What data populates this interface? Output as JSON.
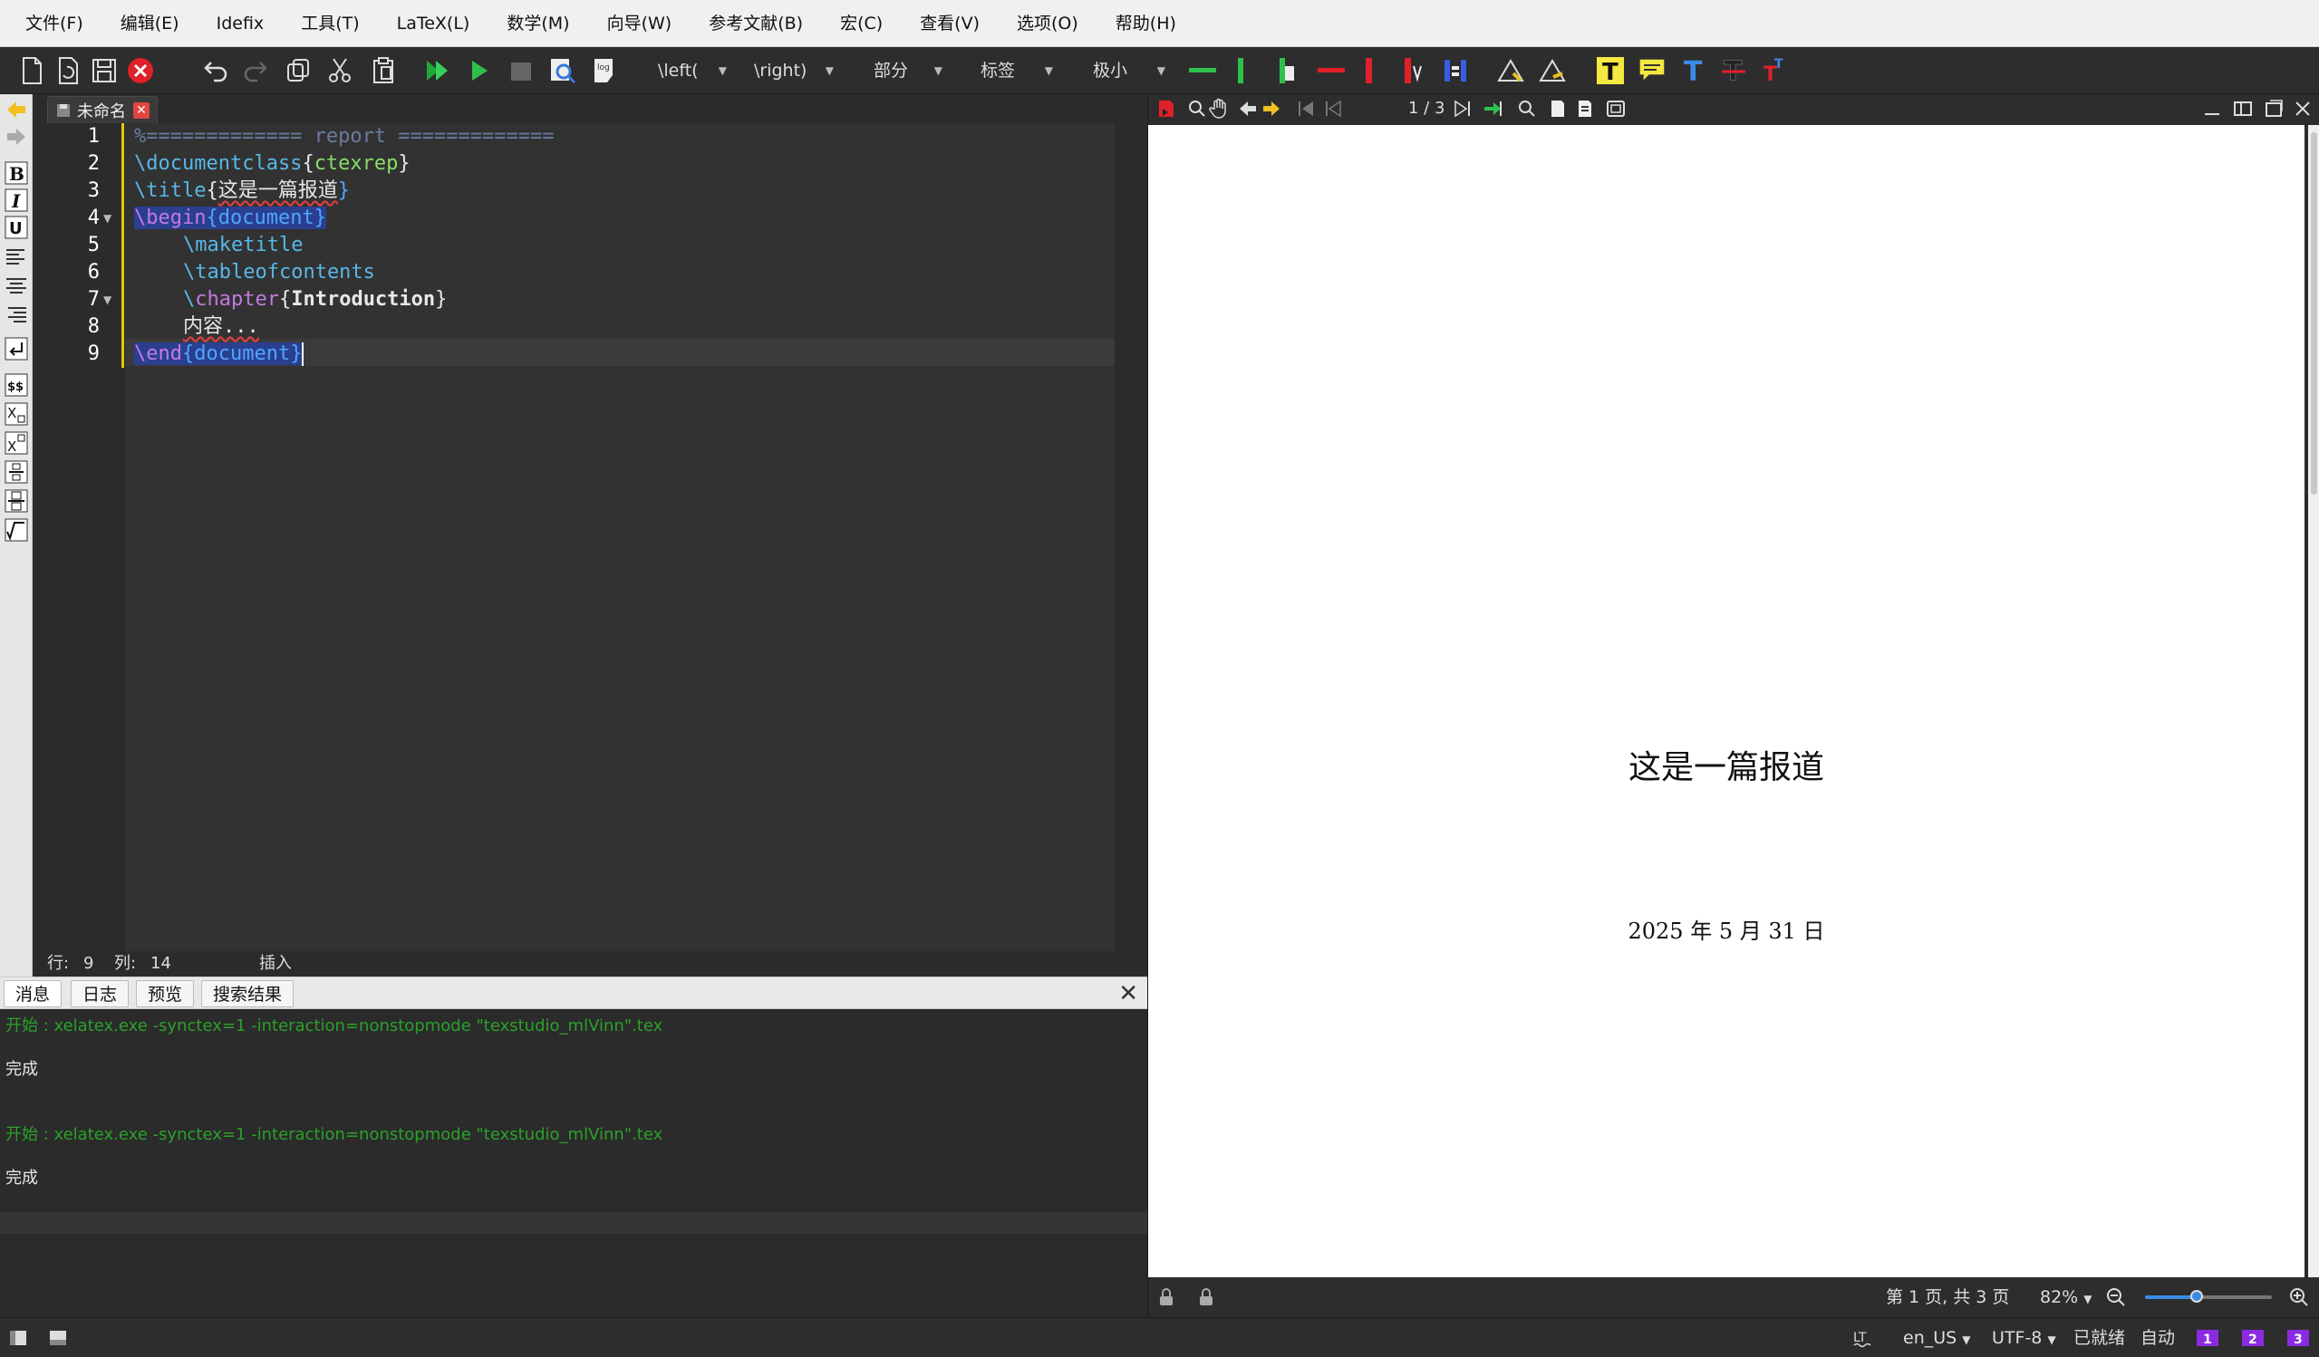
{
  "menubar": {
    "items": [
      "文件(F)",
      "编辑(E)",
      "Idefix",
      "工具(T)",
      "LaTeX(L)",
      "数学(M)",
      "向导(W)",
      "参考文献(B)",
      "宏(C)",
      "查看(V)",
      "选项(O)",
      "帮助(H)"
    ]
  },
  "toolbar": {
    "left_delim": "\\left(",
    "right_delim": "\\right)",
    "section": "部分",
    "label": "标签",
    "size": "极小"
  },
  "editor": {
    "tab_label": "未命名",
    "line_numbers": [
      "1",
      "2",
      "3",
      "4",
      "5",
      "6",
      "7",
      "8",
      "9"
    ],
    "lines": {
      "l1": "%============= report =============",
      "l2_cmd": "\\documentclass",
      "l2_open": "{",
      "l2_arg": "ctexrep",
      "l2_close": "}",
      "l3_cmd": "\\title",
      "l3_open": "{",
      "l3_arg": "这是一篇报道",
      "l3_close": "}",
      "l4_cmd": "\\begin",
      "l4_open": "{",
      "l4_arg": "document",
      "l4_close": "}",
      "l5": "\\maketitle",
      "l6": "\\tableofcontents",
      "l7_slash": "\\",
      "l7_cmd": "chapter",
      "l7_open": "{",
      "l7_arg": "Introduction",
      "l7_close": "}",
      "l8": "内容...",
      "l9_cmd": "\\end",
      "l9_open": "{",
      "l9_arg": "document",
      "l9_close": "}"
    },
    "status": {
      "row_label": "行:",
      "row_value": "9",
      "col_label": "列:",
      "col_value": "14",
      "mode": "插入"
    }
  },
  "panel": {
    "tabs": [
      "消息",
      "日志",
      "预览",
      "搜索结果"
    ],
    "log": {
      "start1": "开始 : xelatex.exe -synctex=1 -interaction=nonstopmode \"texstudio_mlVinn\".tex",
      "done1": "完成",
      "start2": "开始 : xelatex.exe -synctex=1 -interaction=nonstopmode \"texstudio_mlVinn\".tex",
      "done2": "完成"
    }
  },
  "viewer": {
    "page_counter": "1 / 3",
    "pdf_title": "这是一篇报道",
    "pdf_date": "2025 年 5 月 31 日",
    "status_page": "第 1 页, 共 3 页",
    "zoom": "82%"
  },
  "bottombar": {
    "lang": "en_US",
    "encoding": "UTF-8",
    "ready": "已就绪",
    "auto": "自动"
  },
  "colors": {
    "accent_blue": "#4fa6ff",
    "keyword_purple": "#c27ae0",
    "arg_green": "#88dd66",
    "log_green": "#2aa12a"
  }
}
